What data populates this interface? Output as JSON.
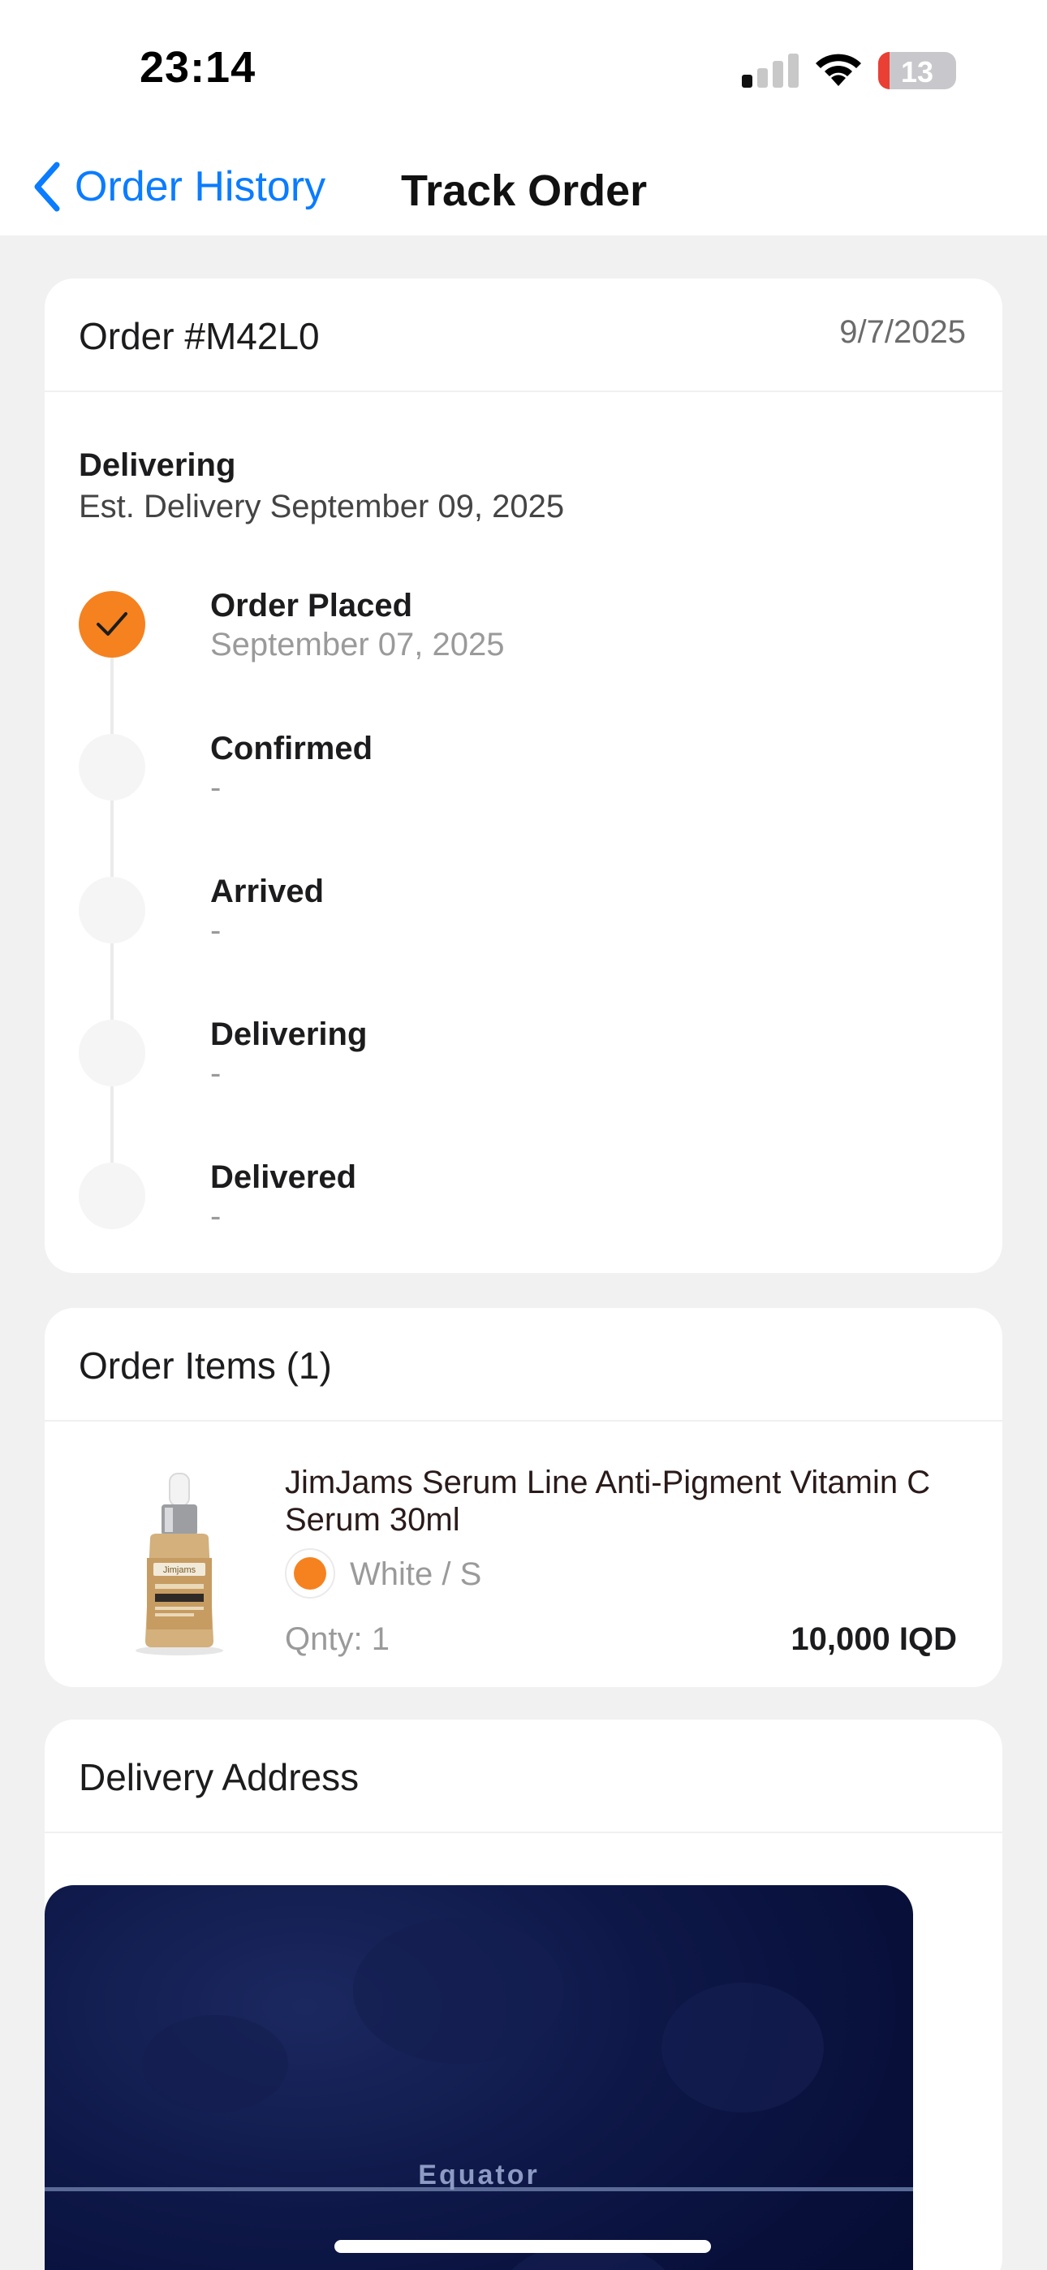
{
  "status_bar": {
    "time": "23:14",
    "battery_level": "13",
    "signal_bars_active": 1,
    "signal_bars_total": 4,
    "icons": [
      "cellular-signal-icon",
      "wifi-icon",
      "battery-icon"
    ]
  },
  "nav": {
    "back_label": "Order History",
    "title": "Track Order",
    "accent_color": "#0A7CFF"
  },
  "order": {
    "number": "Order #M42L0",
    "date": "9/7/2025",
    "status": "Delivering",
    "est_delivery": "Est. Delivery September 09, 2025",
    "steps": [
      {
        "title": "Order Placed",
        "date": "September 07, 2025",
        "done": true
      },
      {
        "title": "Confirmed",
        "date": "-",
        "done": false
      },
      {
        "title": "Arrived",
        "date": "-",
        "done": false
      },
      {
        "title": "Delivering",
        "date": "-",
        "done": false
      },
      {
        "title": "Delivered",
        "date": "-",
        "done": false
      }
    ],
    "step_done_color": "#F5821F"
  },
  "items": {
    "header": "Order Items (1)",
    "list": [
      {
        "name": "JimJams Serum Line Anti-Pigment Vitamin C Serum 30ml",
        "image": "serum-bottle-image",
        "brand_on_label": "Jimjams",
        "swatch_color": "#F5821F",
        "variant": "White / S",
        "qty": "Qnty: 1",
        "price": "10,000 IQD"
      }
    ]
  },
  "delivery": {
    "header": "Delivery Address",
    "map_label": "Equator"
  }
}
